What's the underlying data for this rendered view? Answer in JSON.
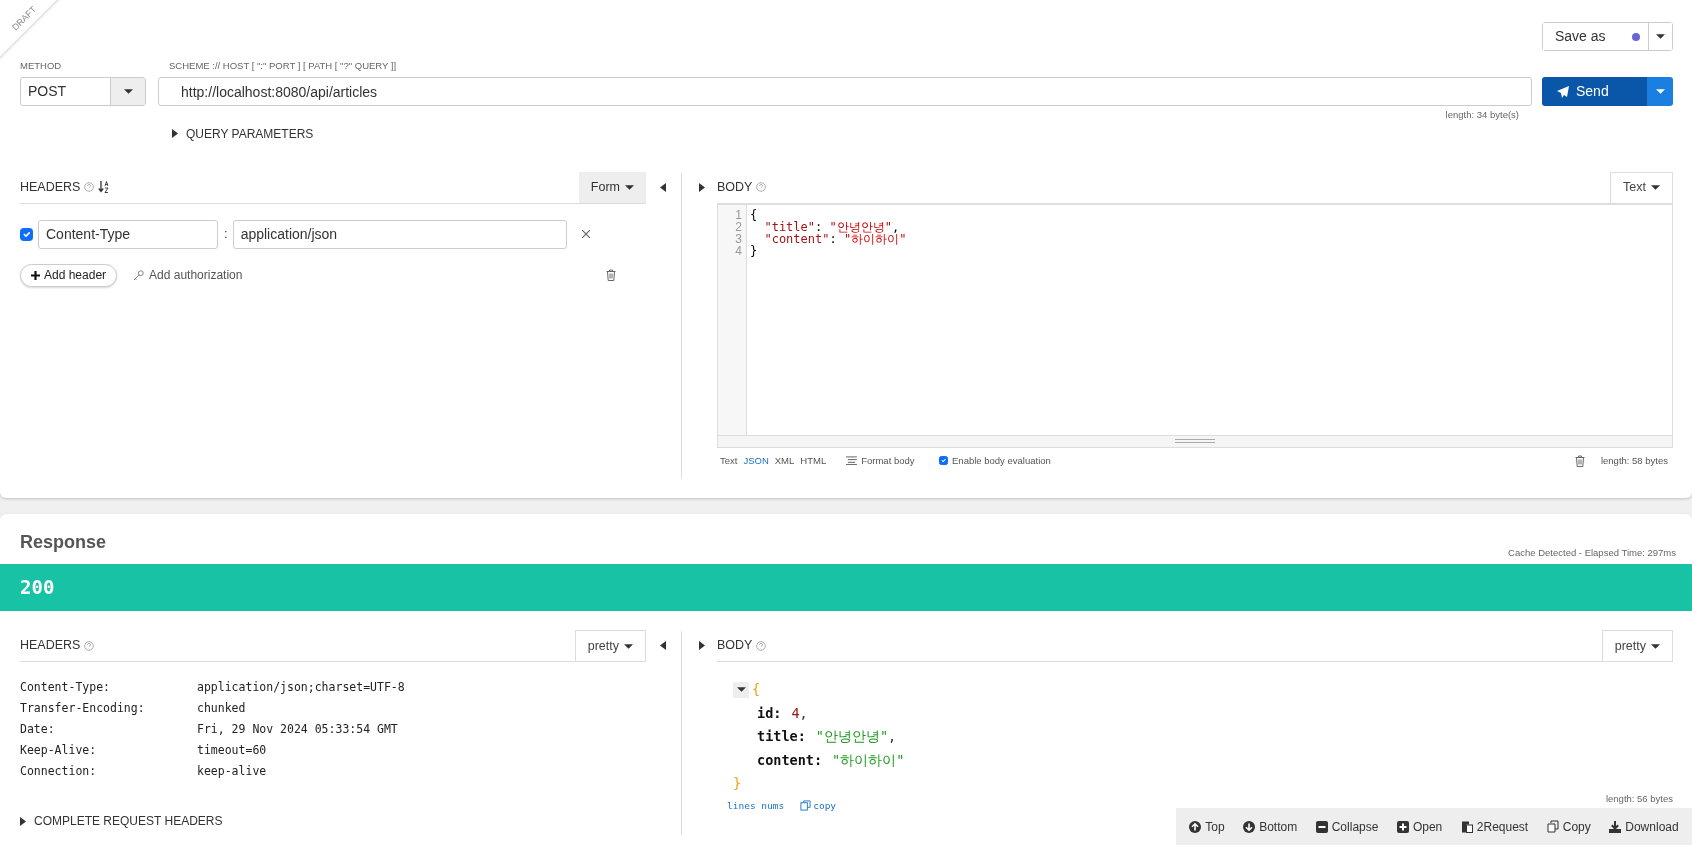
{
  "draft_label": "DRAFT",
  "save_as": {
    "label": "Save as"
  },
  "method": {
    "label": "METHOD",
    "value": "POST"
  },
  "url": {
    "label": "SCHEME :// HOST [ \":\" PORT ] [ PATH [ \"?\" QUERY ]]",
    "value": "http://localhost:8080/api/articles",
    "length": "length: 34 byte(s)"
  },
  "send": {
    "label": "Send"
  },
  "query_parameters": {
    "label": "QUERY PARAMETERS",
    "expanded": false
  },
  "request_headers": {
    "title": "HEADERS",
    "mode": "Form",
    "rows": [
      {
        "checked": true,
        "name": "Content-Type",
        "separator": ":",
        "value": "application/json"
      }
    ],
    "add_header": "Add header",
    "add_authorization": "Add authorization"
  },
  "request_body": {
    "title": "BODY",
    "mode": "Text",
    "lines": [
      {
        "n": "1",
        "tokens": [
          {
            "kind": "punct",
            "text": "{"
          }
        ]
      },
      {
        "n": "2",
        "tokens": [
          {
            "kind": "key",
            "text": "  \"title\""
          },
          {
            "kind": "punct",
            "text": ": "
          },
          {
            "kind": "string",
            "text": "\"안녕안녕\""
          },
          {
            "kind": "punct",
            "text": ","
          }
        ]
      },
      {
        "n": "3",
        "tokens": [
          {
            "kind": "key",
            "text": "  \"content\""
          },
          {
            "kind": "punct",
            "text": ": "
          },
          {
            "kind": "string",
            "text": "\"하이하이\""
          }
        ]
      },
      {
        "n": "4",
        "tokens": [
          {
            "kind": "punct",
            "text": "}"
          }
        ]
      }
    ],
    "formats": [
      {
        "label": "Text",
        "selected": false
      },
      {
        "label": "JSON",
        "selected": true
      },
      {
        "label": "XML",
        "selected": false
      },
      {
        "label": "HTML",
        "selected": false
      }
    ],
    "format_body": "Format body",
    "evaluation": {
      "label": "Enable body evaluation",
      "checked": true
    },
    "length": "length: 58 bytes"
  },
  "response": {
    "title": "Response",
    "timing": "Cache Detected - Elapsed Time: 297ms",
    "status": "200",
    "headers_title": "HEADERS",
    "headers_mode": "pretty",
    "headers": [
      {
        "name": "Content-Type:",
        "value": "application/json;charset=UTF-8"
      },
      {
        "name": "Transfer-Encoding:",
        "value": "chunked"
      },
      {
        "name": "Date:",
        "value": "Fri, 29 Nov 2024 05:33:54 GMT"
      },
      {
        "name": "Keep-Alive:",
        "value": "timeout=60"
      },
      {
        "name": "Connection:",
        "value": "keep-alive"
      }
    ],
    "complete_headers": {
      "label": "COMPLETE REQUEST HEADERS",
      "expanded": false
    },
    "body_title": "BODY",
    "body_mode": "pretty",
    "body": {
      "expanded": true,
      "open": "{",
      "close": "}",
      "fields": [
        {
          "key": "id:",
          "value": "4",
          "kind": "number",
          "punct": ","
        },
        {
          "key": "title:",
          "value": "\"안녕안녕\"",
          "kind": "string",
          "punct": ","
        },
        {
          "key": "content:",
          "value": "\"하이하이\"",
          "kind": "string"
        }
      ]
    },
    "lines_nums": "lines nums",
    "copy": "copy",
    "length": "length: 56 bytes"
  },
  "toolbar": [
    {
      "label": "Top",
      "kind": "up"
    },
    {
      "label": "Bottom",
      "kind": "down"
    },
    {
      "label": "Collapse",
      "kind": "minus"
    },
    {
      "label": "Open",
      "kind": "plus"
    },
    {
      "label": "2Request",
      "kind": "paste"
    },
    {
      "label": "Copy",
      "kind": "copy"
    },
    {
      "label": "Download",
      "kind": "download"
    }
  ]
}
